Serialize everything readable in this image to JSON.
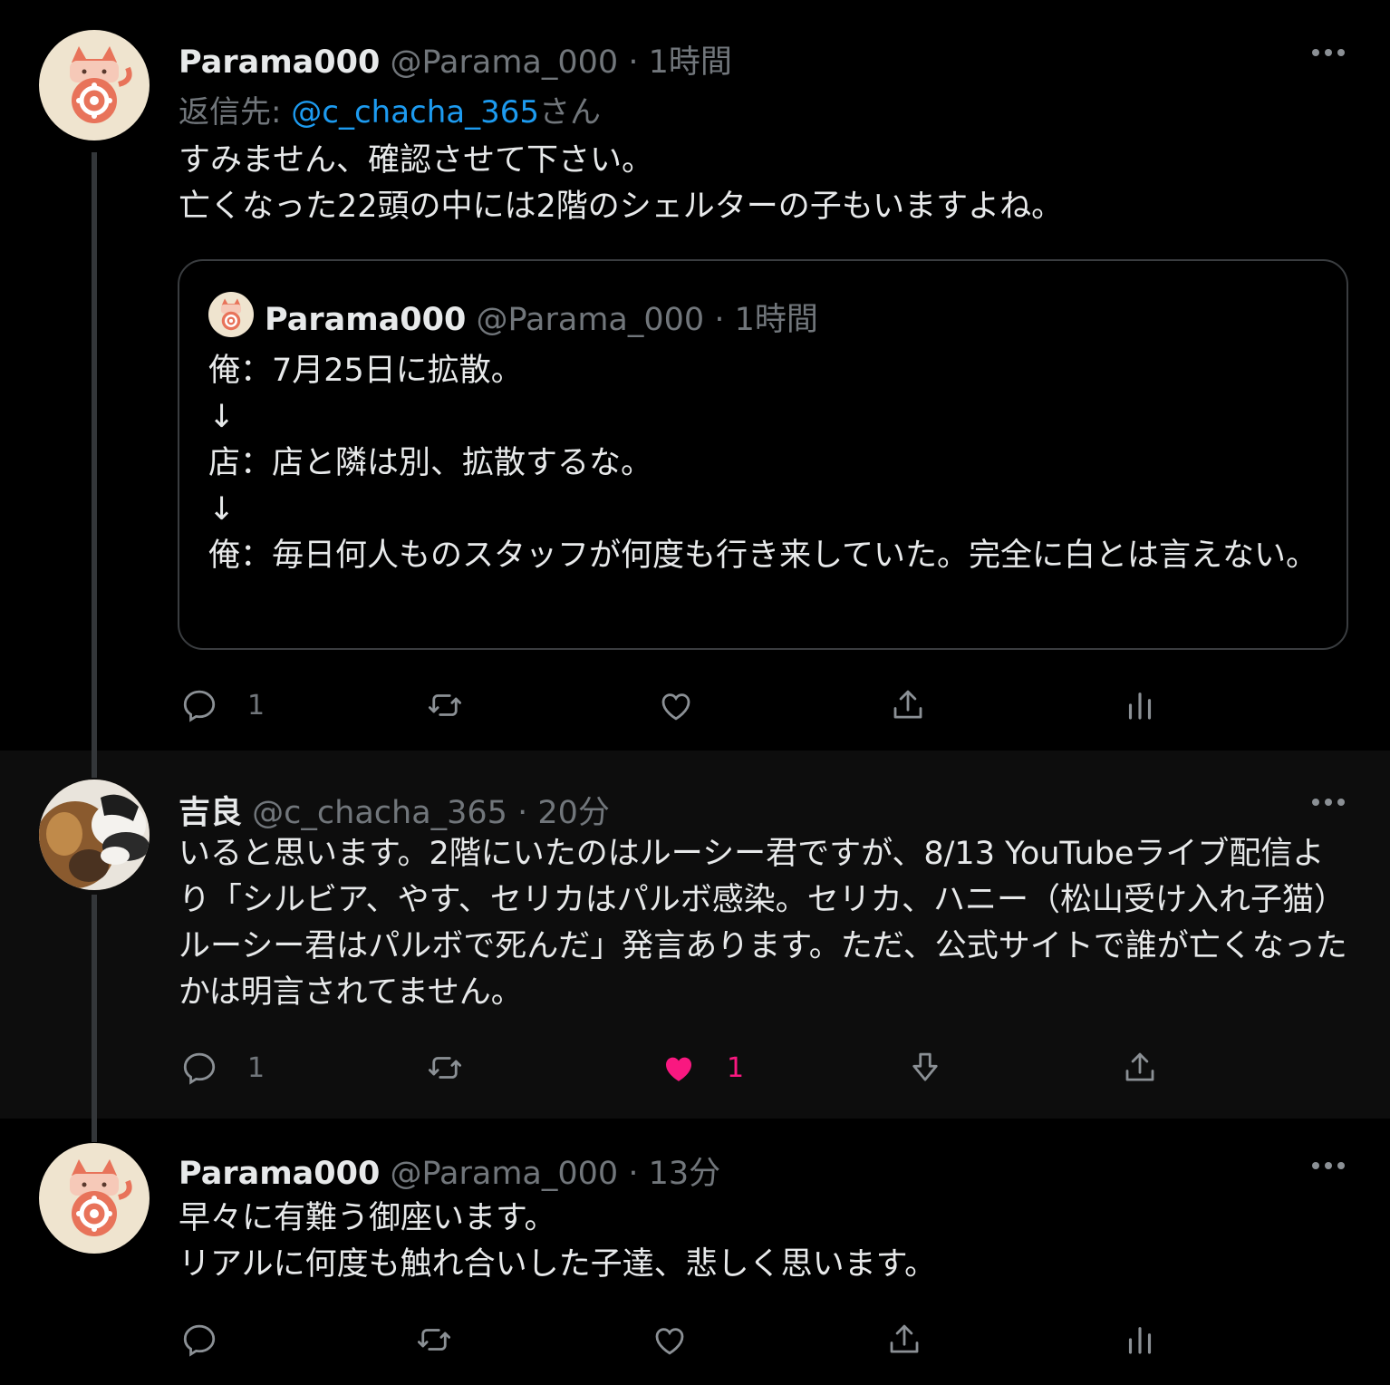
{
  "tweets": [
    {
      "name": "Parama000",
      "handle": "@Parama_000",
      "separator": "·",
      "time": "1時間",
      "reply_prefix": "返信先: ",
      "reply_mention": "@c_chacha_365",
      "reply_suffix": "さん",
      "text": "すみません、確認させて下さい。\n亡くなった22頭の中には2階のシェルターの子もいますよね。",
      "quote": {
        "name": "Parama000",
        "handle": "@Parama_000",
        "separator": "·",
        "time": "1時間",
        "text": "俺：7月25日に拡散。\n↓\n店：店と隣は別、拡散するな。\n↓\n俺：毎日何人ものスタッフが何度も行き来していた。完全に白とは言えない。"
      },
      "actions": {
        "reply_count": "1",
        "retweet_count": "",
        "like_count": ""
      },
      "icons": [
        "reply-icon",
        "retweet-icon",
        "like-icon",
        "share-icon",
        "analytics-icon"
      ]
    },
    {
      "name": "吉良",
      "handle": "@c_chacha_365",
      "separator": "·",
      "time": "20分",
      "text": "いると思います。2階にいたのはルーシー君ですが、8/13 YouTubeライブ配信より「シルビア、やす、セリカはパルボ感染。セリカ、ハニー（松山受け入れ子猫）ルーシー君はパルボで死んだ」発言あります。ただ、公式サイトで誰が亡くなったかは明言されてません。",
      "actions": {
        "reply_count": "1",
        "retweet_count": "",
        "like_count": "1",
        "liked": true
      },
      "icons": [
        "reply-icon",
        "retweet-icon",
        "like-icon-filled",
        "downvote-icon",
        "share-icon"
      ]
    },
    {
      "name": "Parama000",
      "handle": "@Parama_000",
      "separator": "·",
      "time": "13分",
      "text": "早々に有難う御座います。\nリアルに何度も触れ合いした子達、悲しく思います。",
      "actions": {
        "reply_count": "",
        "retweet_count": "",
        "like_count": ""
      },
      "icons": [
        "reply-icon",
        "retweet-icon",
        "like-icon",
        "share-icon",
        "analytics-icon"
      ]
    }
  ],
  "colors": {
    "background": "#000000",
    "highlight_background": "#0d0d0d",
    "text": "#e7e9ea",
    "muted": "#71767b",
    "link": "#1d9bf0",
    "like": "#f91880",
    "avatar_bg": "#efe4cf",
    "avatar_accent": "#e8735a"
  }
}
